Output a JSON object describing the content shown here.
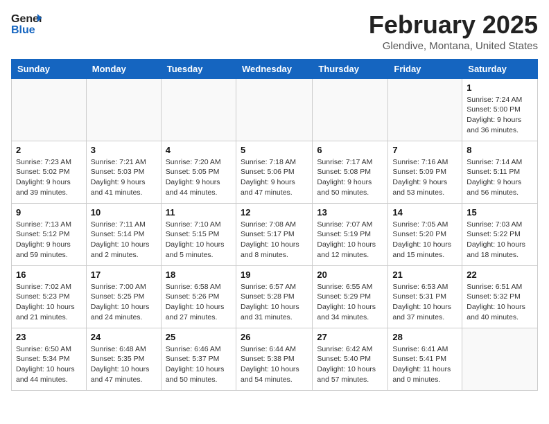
{
  "header": {
    "logo_general": "General",
    "logo_blue": "Blue",
    "month_title": "February 2025",
    "location": "Glendive, Montana, United States"
  },
  "calendar": {
    "days_of_week": [
      "Sunday",
      "Monday",
      "Tuesday",
      "Wednesday",
      "Thursday",
      "Friday",
      "Saturday"
    ],
    "weeks": [
      [
        {
          "day": "",
          "info": ""
        },
        {
          "day": "",
          "info": ""
        },
        {
          "day": "",
          "info": ""
        },
        {
          "day": "",
          "info": ""
        },
        {
          "day": "",
          "info": ""
        },
        {
          "day": "",
          "info": ""
        },
        {
          "day": "1",
          "info": "Sunrise: 7:24 AM\nSunset: 5:00 PM\nDaylight: 9 hours and 36 minutes."
        }
      ],
      [
        {
          "day": "2",
          "info": "Sunrise: 7:23 AM\nSunset: 5:02 PM\nDaylight: 9 hours and 39 minutes."
        },
        {
          "day": "3",
          "info": "Sunrise: 7:21 AM\nSunset: 5:03 PM\nDaylight: 9 hours and 41 minutes."
        },
        {
          "day": "4",
          "info": "Sunrise: 7:20 AM\nSunset: 5:05 PM\nDaylight: 9 hours and 44 minutes."
        },
        {
          "day": "5",
          "info": "Sunrise: 7:18 AM\nSunset: 5:06 PM\nDaylight: 9 hours and 47 minutes."
        },
        {
          "day": "6",
          "info": "Sunrise: 7:17 AM\nSunset: 5:08 PM\nDaylight: 9 hours and 50 minutes."
        },
        {
          "day": "7",
          "info": "Sunrise: 7:16 AM\nSunset: 5:09 PM\nDaylight: 9 hours and 53 minutes."
        },
        {
          "day": "8",
          "info": "Sunrise: 7:14 AM\nSunset: 5:11 PM\nDaylight: 9 hours and 56 minutes."
        }
      ],
      [
        {
          "day": "9",
          "info": "Sunrise: 7:13 AM\nSunset: 5:12 PM\nDaylight: 9 hours and 59 minutes."
        },
        {
          "day": "10",
          "info": "Sunrise: 7:11 AM\nSunset: 5:14 PM\nDaylight: 10 hours and 2 minutes."
        },
        {
          "day": "11",
          "info": "Sunrise: 7:10 AM\nSunset: 5:15 PM\nDaylight: 10 hours and 5 minutes."
        },
        {
          "day": "12",
          "info": "Sunrise: 7:08 AM\nSunset: 5:17 PM\nDaylight: 10 hours and 8 minutes."
        },
        {
          "day": "13",
          "info": "Sunrise: 7:07 AM\nSunset: 5:19 PM\nDaylight: 10 hours and 12 minutes."
        },
        {
          "day": "14",
          "info": "Sunrise: 7:05 AM\nSunset: 5:20 PM\nDaylight: 10 hours and 15 minutes."
        },
        {
          "day": "15",
          "info": "Sunrise: 7:03 AM\nSunset: 5:22 PM\nDaylight: 10 hours and 18 minutes."
        }
      ],
      [
        {
          "day": "16",
          "info": "Sunrise: 7:02 AM\nSunset: 5:23 PM\nDaylight: 10 hours and 21 minutes."
        },
        {
          "day": "17",
          "info": "Sunrise: 7:00 AM\nSunset: 5:25 PM\nDaylight: 10 hours and 24 minutes."
        },
        {
          "day": "18",
          "info": "Sunrise: 6:58 AM\nSunset: 5:26 PM\nDaylight: 10 hours and 27 minutes."
        },
        {
          "day": "19",
          "info": "Sunrise: 6:57 AM\nSunset: 5:28 PM\nDaylight: 10 hours and 31 minutes."
        },
        {
          "day": "20",
          "info": "Sunrise: 6:55 AM\nSunset: 5:29 PM\nDaylight: 10 hours and 34 minutes."
        },
        {
          "day": "21",
          "info": "Sunrise: 6:53 AM\nSunset: 5:31 PM\nDaylight: 10 hours and 37 minutes."
        },
        {
          "day": "22",
          "info": "Sunrise: 6:51 AM\nSunset: 5:32 PM\nDaylight: 10 hours and 40 minutes."
        }
      ],
      [
        {
          "day": "23",
          "info": "Sunrise: 6:50 AM\nSunset: 5:34 PM\nDaylight: 10 hours and 44 minutes."
        },
        {
          "day": "24",
          "info": "Sunrise: 6:48 AM\nSunset: 5:35 PM\nDaylight: 10 hours and 47 minutes."
        },
        {
          "day": "25",
          "info": "Sunrise: 6:46 AM\nSunset: 5:37 PM\nDaylight: 10 hours and 50 minutes."
        },
        {
          "day": "26",
          "info": "Sunrise: 6:44 AM\nSunset: 5:38 PM\nDaylight: 10 hours and 54 minutes."
        },
        {
          "day": "27",
          "info": "Sunrise: 6:42 AM\nSunset: 5:40 PM\nDaylight: 10 hours and 57 minutes."
        },
        {
          "day": "28",
          "info": "Sunrise: 6:41 AM\nSunset: 5:41 PM\nDaylight: 11 hours and 0 minutes."
        },
        {
          "day": "",
          "info": ""
        }
      ]
    ]
  }
}
